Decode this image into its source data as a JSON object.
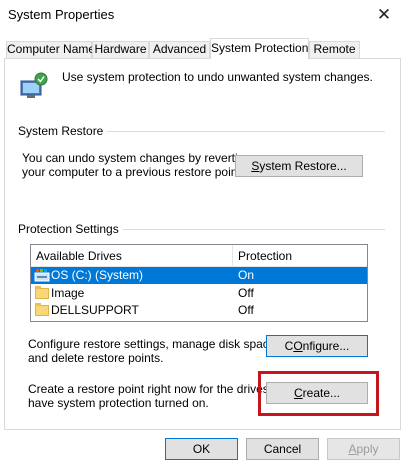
{
  "window": {
    "title": "System Properties",
    "close_label": "✕"
  },
  "tabs": [
    {
      "label": "Computer Name"
    },
    {
      "label": "Hardware"
    },
    {
      "label": "Advanced"
    },
    {
      "label": "System Protection"
    },
    {
      "label": "Remote"
    }
  ],
  "active_tab": "System Protection",
  "intro": {
    "text": "Use system protection to undo unwanted system changes."
  },
  "system_restore": {
    "heading": "System Restore",
    "description_line1": "You can undo system changes by reverting",
    "description_line2": "your computer to a previous restore point.",
    "button_accel": "S",
    "button_rest": "ystem Restore..."
  },
  "protection": {
    "heading": "Protection Settings",
    "columns": {
      "drives": "Available Drives",
      "protection": "Protection"
    },
    "drives": [
      {
        "name": "OS (C:) (System)",
        "protection": "On",
        "selected": true,
        "icon": "system-drive-icon"
      },
      {
        "name": "Image",
        "protection": "Off",
        "selected": false,
        "icon": "folder-drive-icon"
      },
      {
        "name": "DELLSUPPORT",
        "protection": "Off",
        "selected": false,
        "icon": "folder-drive-icon"
      }
    ],
    "configure_text_line1": "Configure restore settings, manage disk space,",
    "configure_text_line2": "and delete restore points.",
    "configure_accel": "O",
    "configure_pre": "C",
    "configure_rest": "nfigure...",
    "create_text_line1": "Create a restore point right now for the drives that",
    "create_text_line2": "have system protection turned on.",
    "create_accel": "C",
    "create_rest": "reate..."
  },
  "footer": {
    "ok": "OK",
    "cancel": "Cancel",
    "apply_accel": "A",
    "apply_rest": "pply"
  },
  "colors": {
    "selection": "#0078d7",
    "highlight_box": "#c4161c"
  }
}
